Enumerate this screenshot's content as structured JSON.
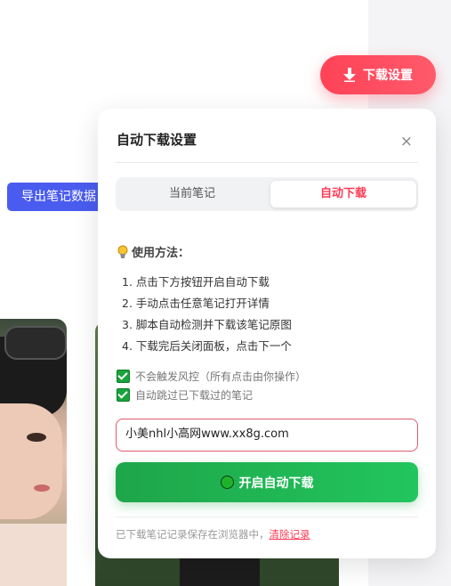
{
  "export_button": {
    "label": "导出笔记数据"
  },
  "download_settings_button": {
    "label": "下载设置",
    "icon": "download-arrow-icon"
  },
  "panel": {
    "title": "自动下载设置",
    "close_glyph": "×",
    "tabs": [
      {
        "label": "当前笔记",
        "active": false
      },
      {
        "label": "自动下载",
        "active": true
      }
    ],
    "howto_title": "使用方法：",
    "howto_icon": "lightbulb-icon",
    "steps": [
      "1. 点击下方按钮开启自动下载",
      "2. 手动点击任意笔记打开详情",
      "3. 脚本自动检测并下载该笔记原图",
      "4. 下载完后关闭面板，点击下一个"
    ],
    "checks": [
      {
        "label": "不会触发风控（所有点击由你操作）",
        "checked": true
      },
      {
        "label": "自动跳过已下载过的笔记",
        "checked": true
      }
    ],
    "input_value": "小美nhl小高网www.xx8g.com",
    "start_button": "开启自动下载",
    "footer_text": "已下载笔记记录保存在浏览器中，",
    "footer_link": "清除记录"
  },
  "colors": {
    "accent_red": "#ff3b54",
    "accent_green": "#22c55e",
    "export_blue": "#4a5cf0"
  }
}
